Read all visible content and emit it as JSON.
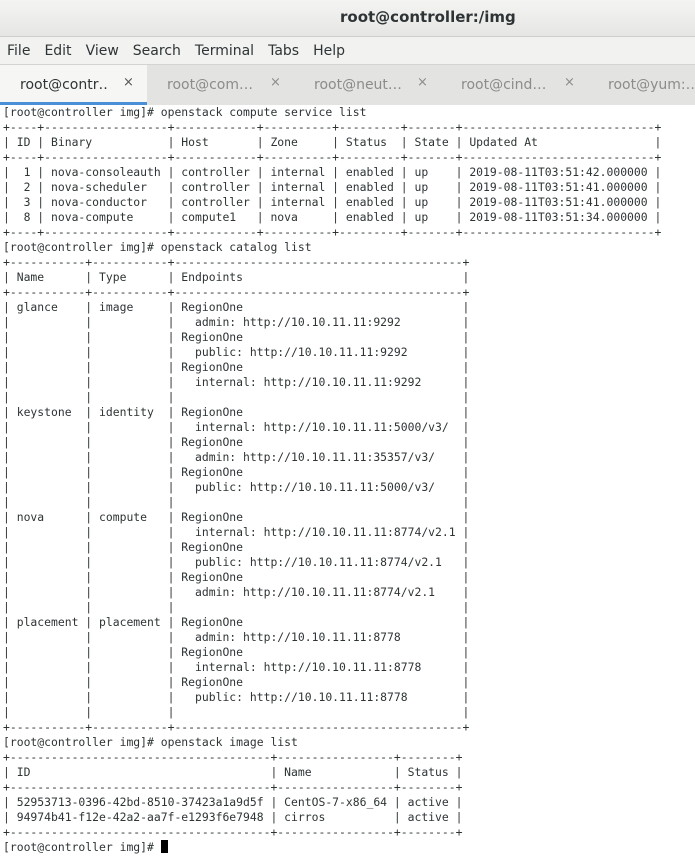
{
  "window": {
    "title": "root@controller:/img"
  },
  "menu": [
    "File",
    "Edit",
    "View",
    "Search",
    "Terminal",
    "Tabs",
    "Help"
  ],
  "tabs": [
    {
      "label": "root@contr…",
      "close": "×"
    },
    {
      "label": "root@com…",
      "close": "×"
    },
    {
      "label": "root@neut…",
      "close": "×"
    },
    {
      "label": "root@cind…",
      "close": "×"
    },
    {
      "label": "root@yum:…",
      "close": ""
    }
  ],
  "terminal": {
    "lines": [
      "[root@controller img]# openstack compute service list",
      "+----+------------------+------------+----------+---------+-------+----------------------------+",
      "| ID | Binary           | Host       | Zone     | Status  | State | Updated At                 |",
      "+----+------------------+------------+----------+---------+-------+----------------------------+",
      "|  1 | nova-consoleauth | controller | internal | enabled | up    | 2019-08-11T03:51:42.000000 |",
      "|  2 | nova-scheduler   | controller | internal | enabled | up    | 2019-08-11T03:51:41.000000 |",
      "|  3 | nova-conductor   | controller | internal | enabled | up    | 2019-08-11T03:51:41.000000 |",
      "|  8 | nova-compute     | compute1   | nova     | enabled | up    | 2019-08-11T03:51:34.000000 |",
      "+----+------------------+------------+----------+---------+-------+----------------------------+",
      "[root@controller img]# openstack catalog list",
      "+-----------+-----------+------------------------------------------+",
      "| Name      | Type      | Endpoints                                |",
      "+-----------+-----------+------------------------------------------+",
      "| glance    | image     | RegionOne                                |",
      "|           |           |   admin: http://10.10.11.11:9292         |",
      "|           |           | RegionOne                                |",
      "|           |           |   public: http://10.10.11.11:9292        |",
      "|           |           | RegionOne                                |",
      "|           |           |   internal: http://10.10.11.11:9292      |",
      "|           |           |                                          |",
      "| keystone  | identity  | RegionOne                                |",
      "|           |           |   internal: http://10.10.11.11:5000/v3/  |",
      "|           |           | RegionOne                                |",
      "|           |           |   admin: http://10.10.11.11:35357/v3/    |",
      "|           |           | RegionOne                                |",
      "|           |           |   public: http://10.10.11.11:5000/v3/    |",
      "|           |           |                                          |",
      "| nova      | compute   | RegionOne                                |",
      "|           |           |   internal: http://10.10.11.11:8774/v2.1 |",
      "|           |           | RegionOne                                |",
      "|           |           |   public: http://10.10.11.11:8774/v2.1   |",
      "|           |           | RegionOne                                |",
      "|           |           |   admin: http://10.10.11.11:8774/v2.1    |",
      "|           |           |                                          |",
      "| placement | placement | RegionOne                                |",
      "|           |           |   admin: http://10.10.11.11:8778         |",
      "|           |           | RegionOne                                |",
      "|           |           |   internal: http://10.10.11.11:8778      |",
      "|           |           | RegionOne                                |",
      "|           |           |   public: http://10.10.11.11:8778        |",
      "|           |           |                                          |",
      "+-----------+-----------+------------------------------------------+",
      "[root@controller img]# openstack image list",
      "+--------------------------------------+-----------------+--------+",
      "| ID                                   | Name            | Status |",
      "+--------------------------------------+-----------------+--------+",
      "| 52953713-0396-42bd-8510-37423a1a9d5f | CentOS-7-x86_64 | active |",
      "| 94974b41-f12e-42a2-aa7f-e1293f6e7948 | cirros          | active |",
      "+--------------------------------------+-----------------+--------+"
    ],
    "prompt": "[root@controller img]# "
  }
}
